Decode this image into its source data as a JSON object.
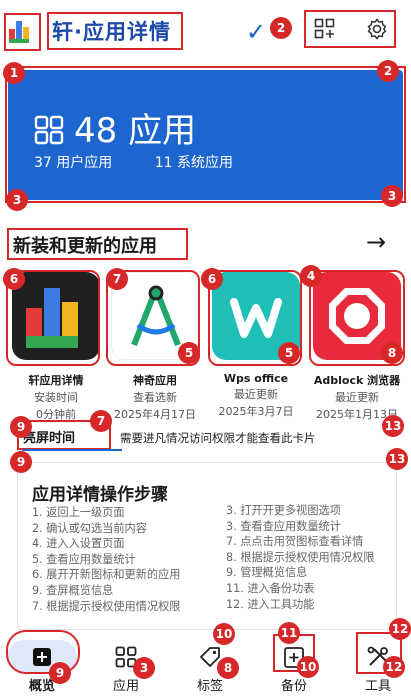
{
  "header": {
    "title": "轩·应用详情"
  },
  "overview": {
    "apps_count": "48 应用",
    "user_apps": "37 用户应用",
    "system_apps": "11 系统应用"
  },
  "new_apps_section": {
    "title": "新装和更新的应用",
    "apps": [
      {
        "name": "轩应用详情",
        "sub": "安装时间",
        "time": "0分钟前",
        "icon": "bar-chart-app-icon"
      },
      {
        "name": "神奇应用",
        "sub": "查看选新",
        "time": "2025年4月17日",
        "icon": "compass-app-icon"
      },
      {
        "name": "Wps office",
        "sub": "最近更新",
        "time": "2025年3月7日",
        "icon": "wps-app-icon"
      },
      {
        "name": "Adblock 浏览器",
        "sub": "最近更新",
        "time": "2025年1月13日",
        "icon": "adblock-app-icon"
      }
    ]
  },
  "screen_time": {
    "tab_label": "亮屏时间",
    "note": "需要进凡情况访问权限才能查看此卡片"
  },
  "steps": {
    "title": "应用详情操作步骤",
    "left": [
      "1. 返回上一级页面",
      "2. 确认或勾选当前内容",
      "4. 进入入设置页面",
      "5. 查看应用数量统计",
      "6. 展开开新图标和更新的应用",
      "9. 查屏概览信息",
      "7. 根据提示授权使用情况权限"
    ],
    "right": [
      "3. 打开开更多视图选项",
      "3. 查看查应用数量统计",
      "7. 点点击用贺图标查看详情",
      "8. 根据提示授权使用情况权限",
      "9. 管理概览信息",
      "11. 进入备份功表",
      "12. 进入工具功能"
    ]
  },
  "tabbar": [
    {
      "label": "概览",
      "icon": "overview-icon"
    },
    {
      "label": "应用",
      "icon": "apps-grid-icon"
    },
    {
      "label": "标签",
      "icon": "tag-icon"
    },
    {
      "label": "备份",
      "icon": "backup-icon"
    },
    {
      "label": "工具",
      "icon": "tools-icon"
    }
  ],
  "badges": [
    "1",
    "2",
    "3",
    "4",
    "5",
    "6",
    "7",
    "8",
    "9",
    "10",
    "11",
    "12",
    "13"
  ],
  "colors": {
    "accent": "#1e66cf",
    "annotation": "#d62828",
    "title_blue": "#1b4aa8"
  }
}
